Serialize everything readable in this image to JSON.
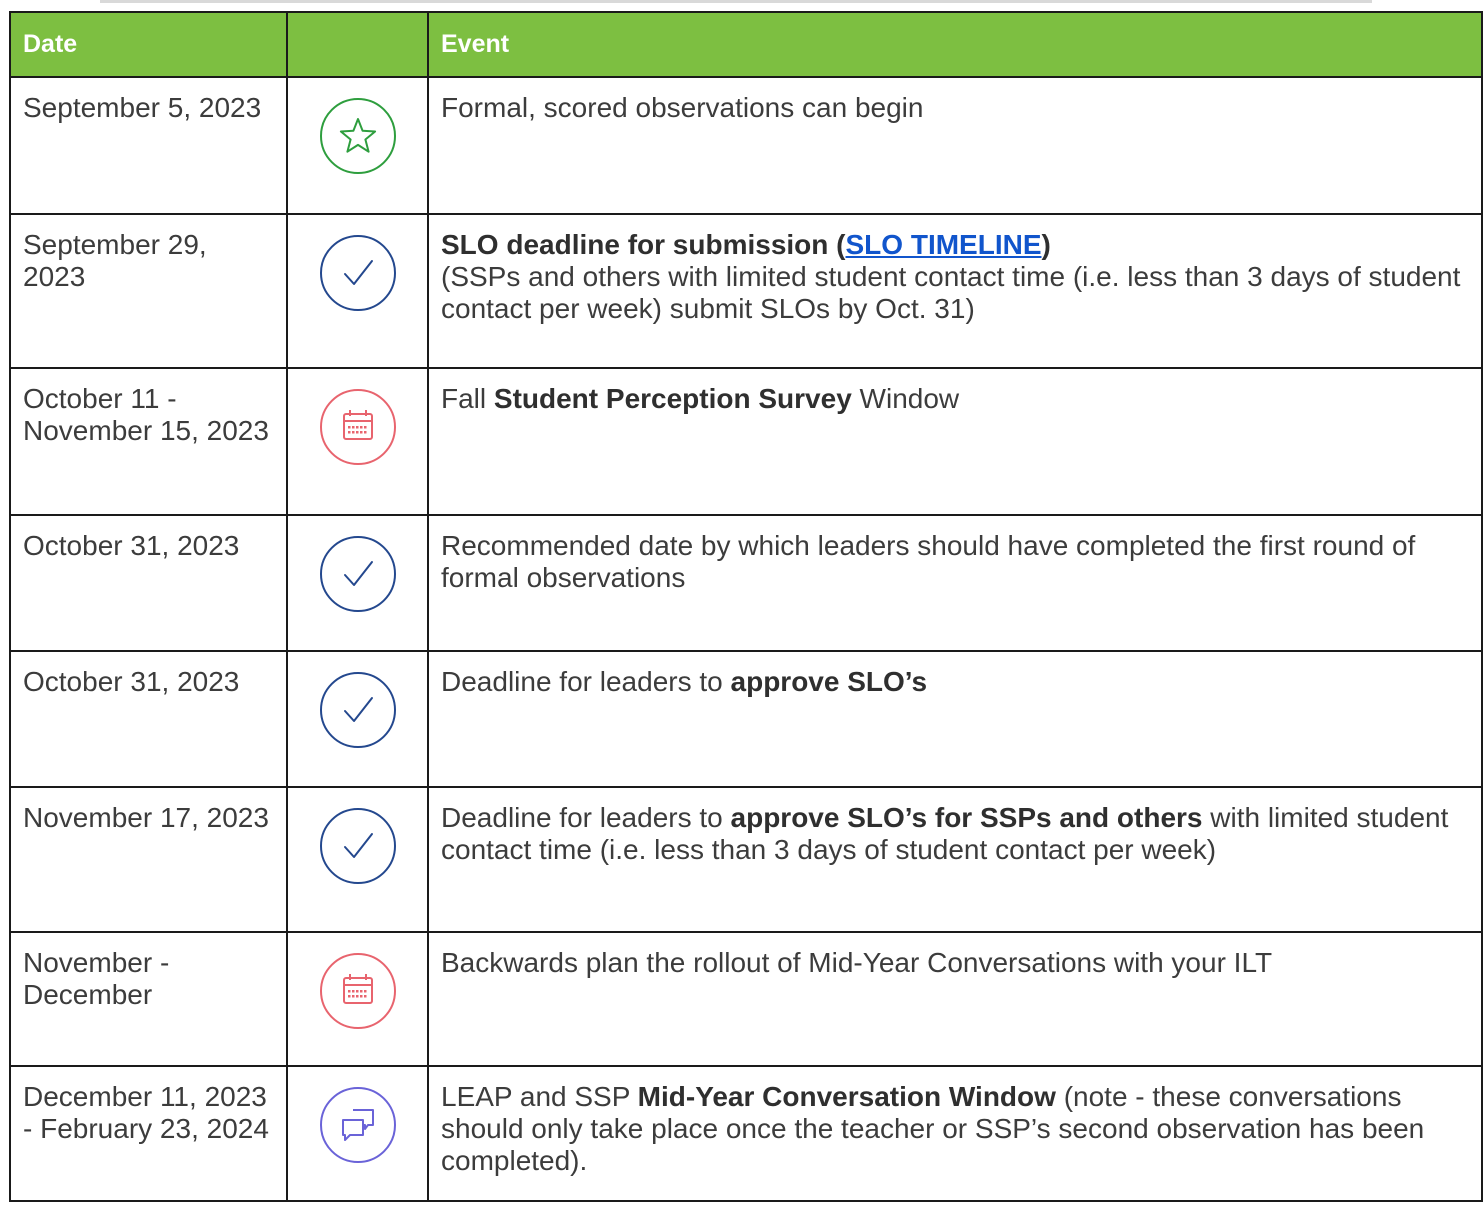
{
  "header": {
    "date": "Date",
    "icon": "",
    "event": "Event"
  },
  "colors": {
    "header_bg": "#7dbf41",
    "star_icon": "#2e9e3e",
    "check_icon": "#24488e",
    "calendar_icon": "#e8646e",
    "chat_icon": "#6a63d8",
    "link": "#1155cc"
  },
  "rows": [
    {
      "date": "September 5, 2023",
      "icon": "star-icon",
      "event": {
        "p1": "Formal, scored observations can begin"
      }
    },
    {
      "date": "September 29, 2023",
      "icon": "check-icon",
      "event": {
        "b1": "SLO deadline for submission (",
        "link": "SLO TIMELINE",
        "b2": ")",
        "p2": "(SSPs and others  with limited student contact time (i.e. less than 3 days of student contact  per week) submit SLOs  by Oct. 31)"
      }
    },
    {
      "date": "October 11 - November 15, 2023",
      "icon": "calendar-icon",
      "event": {
        "p1": "Fall ",
        "b1": "Student Perception Survey",
        "p2": " Window"
      }
    },
    {
      "date": "October 31, 2023",
      "icon": "check-icon",
      "event": {
        "p1": "Recommended date by which leaders should have completed the first round of formal observations"
      }
    },
    {
      "date": "October 31, 2023",
      "icon": "check-icon",
      "event": {
        "p1": "Deadline for leaders to ",
        "b1": "approve SLO’s"
      }
    },
    {
      "date": "November 17, 2023",
      "icon": "check-icon",
      "event": {
        "p1": "Deadline for leaders to ",
        "b1": "approve SLO’s for SSPs and others",
        "p2": "  with limited student contact time (i.e. less than 3 days of student contact  per week)"
      }
    },
    {
      "date": "November - December",
      "icon": "calendar-icon",
      "event": {
        "p1": "Backwards plan the rollout of Mid-Year Conversations with your ILT"
      }
    },
    {
      "date": "December 11, 2023 - February 23, 2024",
      "icon": "chat-icon",
      "event": {
        "p1": "LEAP and SSP ",
        "b1": "Mid-Year Conversation Window",
        "p2": " (note - these conversations should only take place once the teacher or SSP’s second observation has been completed)."
      }
    }
  ]
}
